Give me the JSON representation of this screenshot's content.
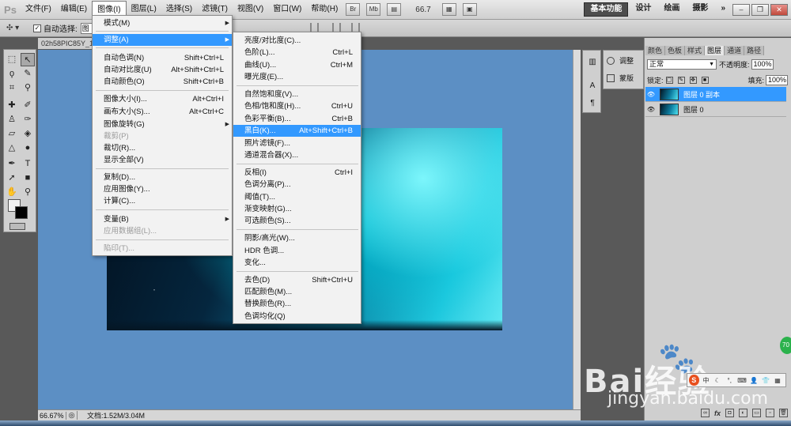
{
  "app": {
    "logo": "Ps",
    "menus": [
      "文件(F)",
      "编辑(E)",
      "图像(I)",
      "图层(L)",
      "选择(S)",
      "滤镜(T)",
      "视图(V)",
      "窗口(W)",
      "帮助(H)"
    ],
    "menubar_buttons": [
      "Br",
      "Mb"
    ],
    "zoom_menu": "66.7",
    "workspaces": [
      "基本功能",
      "设计",
      "绘画",
      "摄影"
    ],
    "more_workspaces": "»"
  },
  "options": {
    "auto_select_label": "自动选择:",
    "auto_select_target": "图"
  },
  "document": {
    "tab": "02h58PIC85Y_1",
    "zoom": "66.67%",
    "doc_size": "文档:1.52M/3.04M"
  },
  "image_menu": {
    "items": [
      {
        "label": "模式(M)",
        "shortcut": "",
        "arrow": true,
        "disabled": false
      },
      {
        "label": "调整(A)",
        "shortcut": "",
        "arrow": true,
        "disabled": false,
        "highlight": true
      },
      {
        "label": "自动色调(N)",
        "shortcut": "Shift+Ctrl+L"
      },
      {
        "label": "自动对比度(U)",
        "shortcut": "Alt+Shift+Ctrl+L"
      },
      {
        "label": "自动颜色(O)",
        "shortcut": "Shift+Ctrl+B"
      },
      {
        "label": "图像大小(I)...",
        "shortcut": "Alt+Ctrl+I"
      },
      {
        "label": "画布大小(S)...",
        "shortcut": "Alt+Ctrl+C"
      },
      {
        "label": "图像旋转(G)",
        "shortcut": "",
        "arrow": true
      },
      {
        "label": "裁剪(P)",
        "shortcut": "",
        "disabled": true
      },
      {
        "label": "裁切(R)...",
        "shortcut": ""
      },
      {
        "label": "显示全部(V)",
        "shortcut": ""
      },
      {
        "label": "复制(D)...",
        "shortcut": ""
      },
      {
        "label": "应用图像(Y)...",
        "shortcut": ""
      },
      {
        "label": "计算(C)...",
        "shortcut": ""
      },
      {
        "label": "变量(B)",
        "shortcut": "",
        "arrow": true
      },
      {
        "label": "应用数据组(L)...",
        "shortcut": "",
        "disabled": true
      },
      {
        "label": "陷印(T)...",
        "shortcut": "",
        "disabled": true
      }
    ]
  },
  "adjust_menu": {
    "items": [
      {
        "label": "亮度/对比度(C)...",
        "shortcut": ""
      },
      {
        "label": "色阶(L)...",
        "shortcut": "Ctrl+L"
      },
      {
        "label": "曲线(U)...",
        "shortcut": "Ctrl+M"
      },
      {
        "label": "曝光度(E)...",
        "shortcut": ""
      },
      {
        "label": "自然饱和度(V)...",
        "shortcut": ""
      },
      {
        "label": "色相/饱和度(H)...",
        "shortcut": "Ctrl+U"
      },
      {
        "label": "色彩平衡(B)...",
        "shortcut": "Ctrl+B"
      },
      {
        "label": "黑白(K)...",
        "shortcut": "Alt+Shift+Ctrl+B",
        "highlight": true
      },
      {
        "label": "照片滤镜(F)...",
        "shortcut": ""
      },
      {
        "label": "通道混合器(X)...",
        "shortcut": ""
      },
      {
        "label": "反相(I)",
        "shortcut": "Ctrl+I"
      },
      {
        "label": "色调分离(P)...",
        "shortcut": ""
      },
      {
        "label": "阈值(T)...",
        "shortcut": ""
      },
      {
        "label": "渐变映射(G)...",
        "shortcut": ""
      },
      {
        "label": "可选颜色(S)...",
        "shortcut": ""
      },
      {
        "label": "阴影/高光(W)...",
        "shortcut": ""
      },
      {
        "label": "HDR 色调...",
        "shortcut": ""
      },
      {
        "label": "变化...",
        "shortcut": ""
      },
      {
        "label": "去色(D)",
        "shortcut": "Shift+Ctrl+U"
      },
      {
        "label": "匹配颜色(M)...",
        "shortcut": ""
      },
      {
        "label": "替换颜色(R)...",
        "shortcut": ""
      },
      {
        "label": "色调均化(Q)",
        "shortcut": ""
      }
    ]
  },
  "adjust_panel": {
    "adjust_label": "调整",
    "mask_label": "蒙版"
  },
  "layers_panel": {
    "tabs": [
      "颜色",
      "色板",
      "样式",
      "图层",
      "通道",
      "路径"
    ],
    "active_tab": "图层",
    "blend_mode": "正常",
    "opacity_label": "不透明度:",
    "opacity_value": "100%",
    "lock_label": "锁定:",
    "fill_label": "填充:",
    "fill_value": "100%",
    "layers": [
      "图层 0 副本",
      "图层 0"
    ],
    "footer_icons": [
      "fx"
    ]
  },
  "watermark": {
    "brand": "Bai经验",
    "url": "jingyan.baidu.com",
    "badge": "70"
  },
  "colors": {
    "highlight": "#3399ff",
    "canvas_bg": "#5c8fc4",
    "foreground": "#f1f1f1",
    "background": "#000000"
  }
}
